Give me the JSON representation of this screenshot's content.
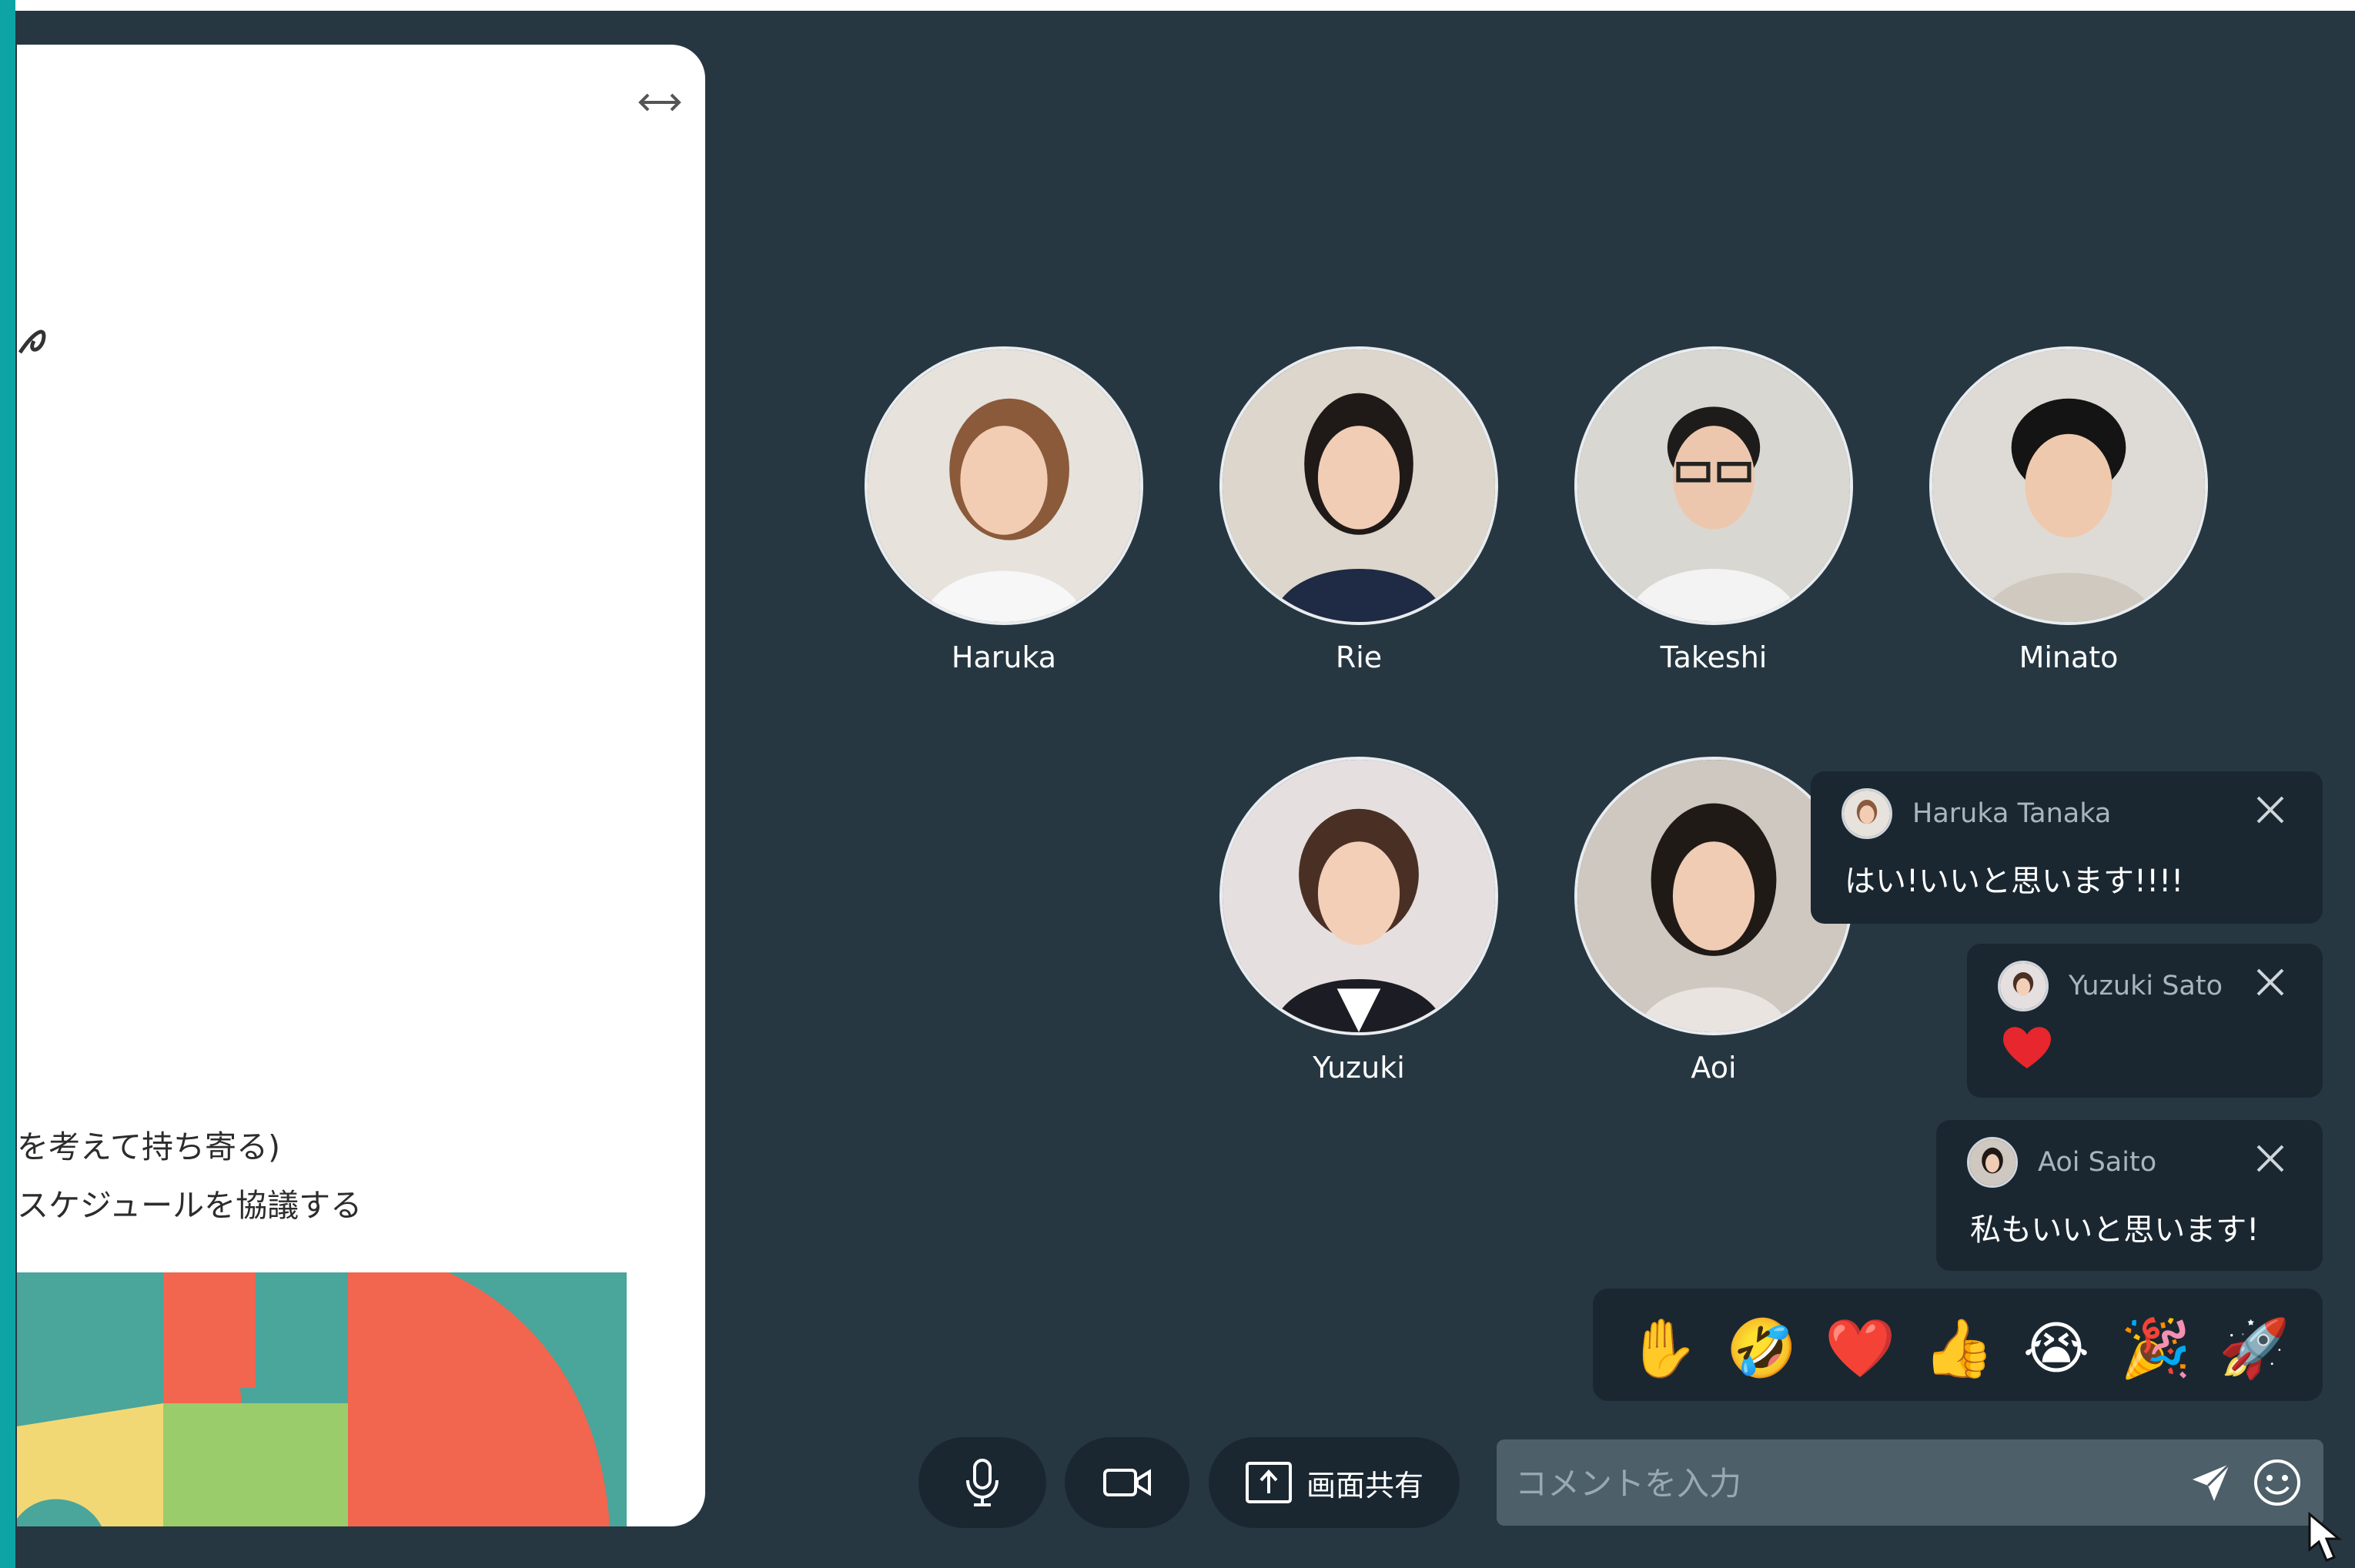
{
  "document": {
    "line1": "を考えて持ち寄る)",
    "line2": "スケジュールを協議する"
  },
  "participants": [
    {
      "name": "Haruka"
    },
    {
      "name": "Rie"
    },
    {
      "name": "Takeshi"
    },
    {
      "name": "Minato"
    },
    {
      "name": "Yuzuki"
    },
    {
      "name": "Aoi"
    }
  ],
  "comments": [
    {
      "author": "Haruka Tanaka",
      "text": "はい!いいと思います!!!!"
    },
    {
      "author": "Yuzuki Sato",
      "text": "❤️"
    },
    {
      "author": "Aoi Saito",
      "text": "私もいいと思います!"
    }
  ],
  "reactions": [
    "✋",
    "🤣",
    "❤️",
    "👍",
    "😭",
    "🎉",
    "🚀"
  ],
  "controls": {
    "mic_icon": "microphone-icon",
    "camera_icon": "video-camera-icon",
    "share_label": "画面共有"
  },
  "comment_input": {
    "placeholder": "コメントを入力",
    "value": ""
  },
  "colors": {
    "background": "#263742",
    "panel": "#1a2731",
    "accent_bar": "#0ea3a5",
    "art_teal": "#4aa59b",
    "art_coral": "#f2654f",
    "art_green": "#9bcc6b",
    "art_yellow": "#f2d874"
  }
}
